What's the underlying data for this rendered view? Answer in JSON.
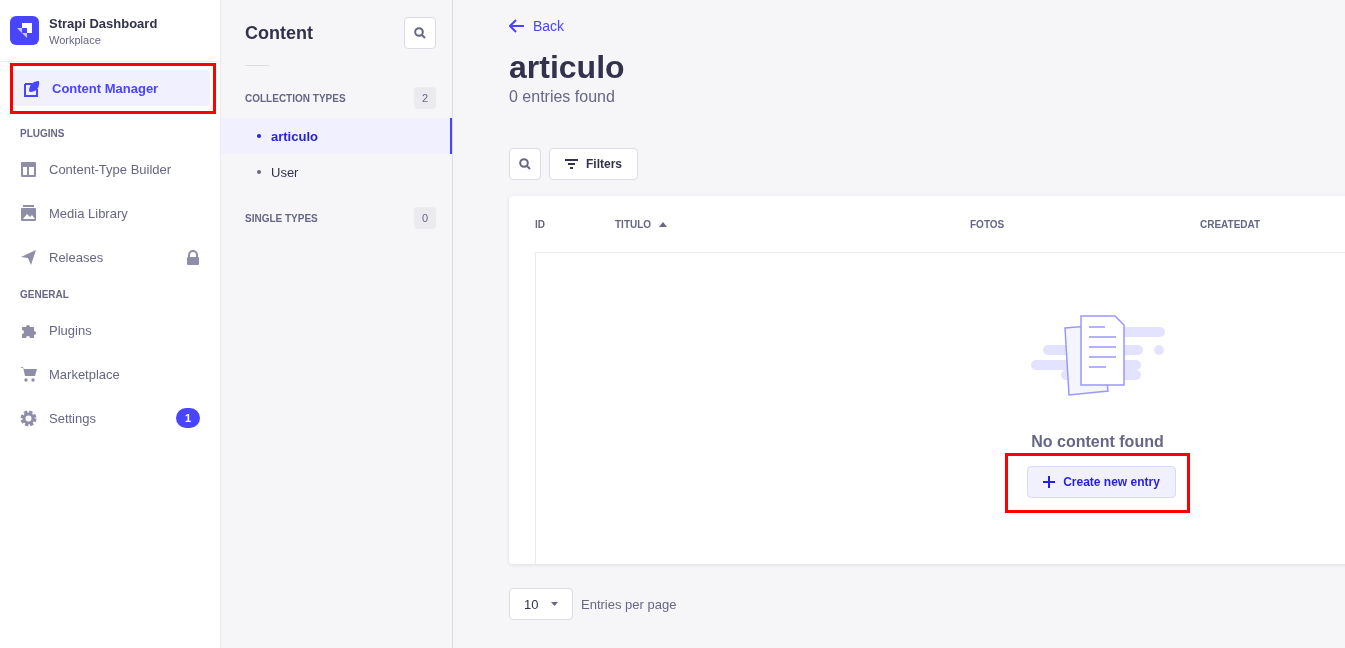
{
  "brand": {
    "title": "Strapi Dashboard",
    "subtitle": "Workplace"
  },
  "nav": [
    {
      "kind": "item",
      "label": "Content Manager",
      "selected": true,
      "highlighted": true
    },
    {
      "kind": "heading",
      "label": "PLUGINS"
    },
    {
      "kind": "item",
      "label": "Content-Type Builder",
      "selected": false
    },
    {
      "kind": "item",
      "label": "Media Library",
      "selected": false
    },
    {
      "kind": "item",
      "label": "Releases",
      "selected": false,
      "locked": true
    },
    {
      "kind": "heading",
      "label": "GENERAL"
    },
    {
      "kind": "item",
      "label": "Plugins",
      "selected": false
    },
    {
      "kind": "item",
      "label": "Marketplace",
      "selected": false
    },
    {
      "kind": "item",
      "label": "Settings",
      "selected": false,
      "badge": "1"
    }
  ],
  "content_panel": {
    "title": "Content",
    "sections": [
      {
        "label": "COLLECTION TYPES",
        "count": "2",
        "items": [
          {
            "label": "articulo",
            "selected": true
          },
          {
            "label": "User",
            "selected": false
          }
        ]
      },
      {
        "label": "SINGLE TYPES",
        "count": "0"
      }
    ]
  },
  "main": {
    "back": "Back",
    "title": "articulo",
    "subtitle": "0 entries found",
    "filters": "Filters",
    "columns": [
      {
        "label": "ID",
        "sorted": false
      },
      {
        "label": "TITULO",
        "sorted": true
      },
      {
        "label": "FOTOS",
        "sorted": false
      },
      {
        "label": "CREATEDAT",
        "sorted": false
      }
    ],
    "empty_text": "No content found",
    "create_button": {
      "label": "Create new entry",
      "highlighted": true
    },
    "page_size": "10",
    "page_size_label": "Entries per page"
  }
}
